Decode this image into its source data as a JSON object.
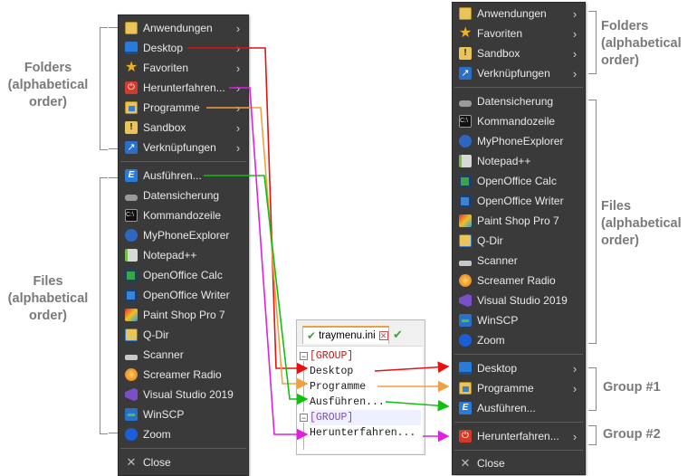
{
  "left_menu": {
    "items": [
      {
        "label": "Anwendungen",
        "icon": "folder-icon",
        "submenu": true
      },
      {
        "label": "Desktop",
        "icon": "desktop-icon",
        "submenu": true
      },
      {
        "label": "Favoriten",
        "icon": "star-icon",
        "submenu": true
      },
      {
        "label": "Herunterfahren...",
        "icon": "power-icon",
        "submenu": true
      },
      {
        "label": "Programme",
        "icon": "programs-icon",
        "submenu": true
      },
      {
        "label": "Sandbox",
        "icon": "warning-icon",
        "submenu": true
      },
      {
        "label": "Verknüpfungen",
        "icon": "shortcut-icon",
        "submenu": true
      },
      {
        "label": "Ausführen...",
        "icon": "run-icon",
        "submenu": false
      },
      {
        "label": "Datensicherung",
        "icon": "drive-icon",
        "submenu": false
      },
      {
        "label": "Kommandozeile",
        "icon": "cmd-icon",
        "submenu": false
      },
      {
        "label": "MyPhoneExplorer",
        "icon": "phone-icon",
        "submenu": false
      },
      {
        "label": "Notepad++",
        "icon": "notepad-icon",
        "submenu": false
      },
      {
        "label": "OpenOffice Calc",
        "icon": "calc-icon",
        "submenu": false
      },
      {
        "label": "OpenOffice Writer",
        "icon": "writer-icon",
        "submenu": false
      },
      {
        "label": "Paint Shop Pro 7",
        "icon": "paint-icon",
        "submenu": false
      },
      {
        "label": "Q-Dir",
        "icon": "qdir-icon",
        "submenu": false
      },
      {
        "label": "Scanner",
        "icon": "scanner-icon",
        "submenu": false
      },
      {
        "label": "Screamer Radio",
        "icon": "radio-icon",
        "submenu": false
      },
      {
        "label": "Visual Studio 2019",
        "icon": "visual-studio-icon",
        "submenu": false
      },
      {
        "label": "WinSCP",
        "icon": "winscp-icon",
        "submenu": false
      },
      {
        "label": "Zoom",
        "icon": "zoom-icon",
        "submenu": false
      }
    ],
    "close_label": "Close"
  },
  "right_menu": {
    "items": [
      {
        "label": "Anwendungen",
        "icon": "folder-icon",
        "submenu": true
      },
      {
        "label": "Favoriten",
        "icon": "star-icon",
        "submenu": true
      },
      {
        "label": "Sandbox",
        "icon": "warning-icon",
        "submenu": true
      },
      {
        "label": "Verknüpfungen",
        "icon": "shortcut-icon",
        "submenu": true
      },
      {
        "label": "Datensicherung",
        "icon": "drive-icon",
        "submenu": false
      },
      {
        "label": "Kommandozeile",
        "icon": "cmd-icon",
        "submenu": false
      },
      {
        "label": "MyPhoneExplorer",
        "icon": "phone-icon",
        "submenu": false
      },
      {
        "label": "Notepad++",
        "icon": "notepad-icon",
        "submenu": false
      },
      {
        "label": "OpenOffice Calc",
        "icon": "calc-icon",
        "submenu": false
      },
      {
        "label": "OpenOffice Writer",
        "icon": "writer-icon",
        "submenu": false
      },
      {
        "label": "Paint Shop Pro 7",
        "icon": "paint-icon",
        "submenu": false
      },
      {
        "label": "Q-Dir",
        "icon": "qdir-icon",
        "submenu": false
      },
      {
        "label": "Scanner",
        "icon": "scanner-icon",
        "submenu": false
      },
      {
        "label": "Screamer Radio",
        "icon": "radio-icon",
        "submenu": false
      },
      {
        "label": "Visual Studio 2019",
        "icon": "visual-studio-icon",
        "submenu": false
      },
      {
        "label": "WinSCP",
        "icon": "winscp-icon",
        "submenu": false
      },
      {
        "label": "Zoom",
        "icon": "zoom-icon",
        "submenu": false
      },
      {
        "label": "Desktop",
        "icon": "desktop-icon",
        "submenu": true
      },
      {
        "label": "Programme",
        "icon": "programs-icon",
        "submenu": true
      },
      {
        "label": "Ausführen...",
        "icon": "run-icon",
        "submenu": false
      },
      {
        "label": "Herunterfahren...",
        "icon": "power-icon",
        "submenu": true
      }
    ],
    "close_label": "Close"
  },
  "annotations": {
    "folders": "Folders (alphabetical order)",
    "files": "Files (alphabetical order)",
    "group1": "Group #1",
    "group2": "Group #2"
  },
  "editor": {
    "tab_label": "traymenu.ini",
    "lines": [
      {
        "text": "[GROUP]",
        "kind": "group"
      },
      {
        "text": "Desktop",
        "kind": "entry"
      },
      {
        "text": "Programme",
        "kind": "entry"
      },
      {
        "text": "Ausführen...",
        "kind": "entry"
      },
      {
        "text": "[GROUP]",
        "kind": "group"
      },
      {
        "text": "Herunterfahren...",
        "kind": "entry"
      }
    ]
  },
  "colors": {
    "menu_bg": "#3a3a3a",
    "annotation_text": "#7a7a7a",
    "desktop_arrow": "#e81010",
    "programme_arrow": "#f0a040",
    "ausfuehren_arrow": "#10c010",
    "herunterfahren_arrow": "#e020e0",
    "group_text": "#b22020"
  }
}
